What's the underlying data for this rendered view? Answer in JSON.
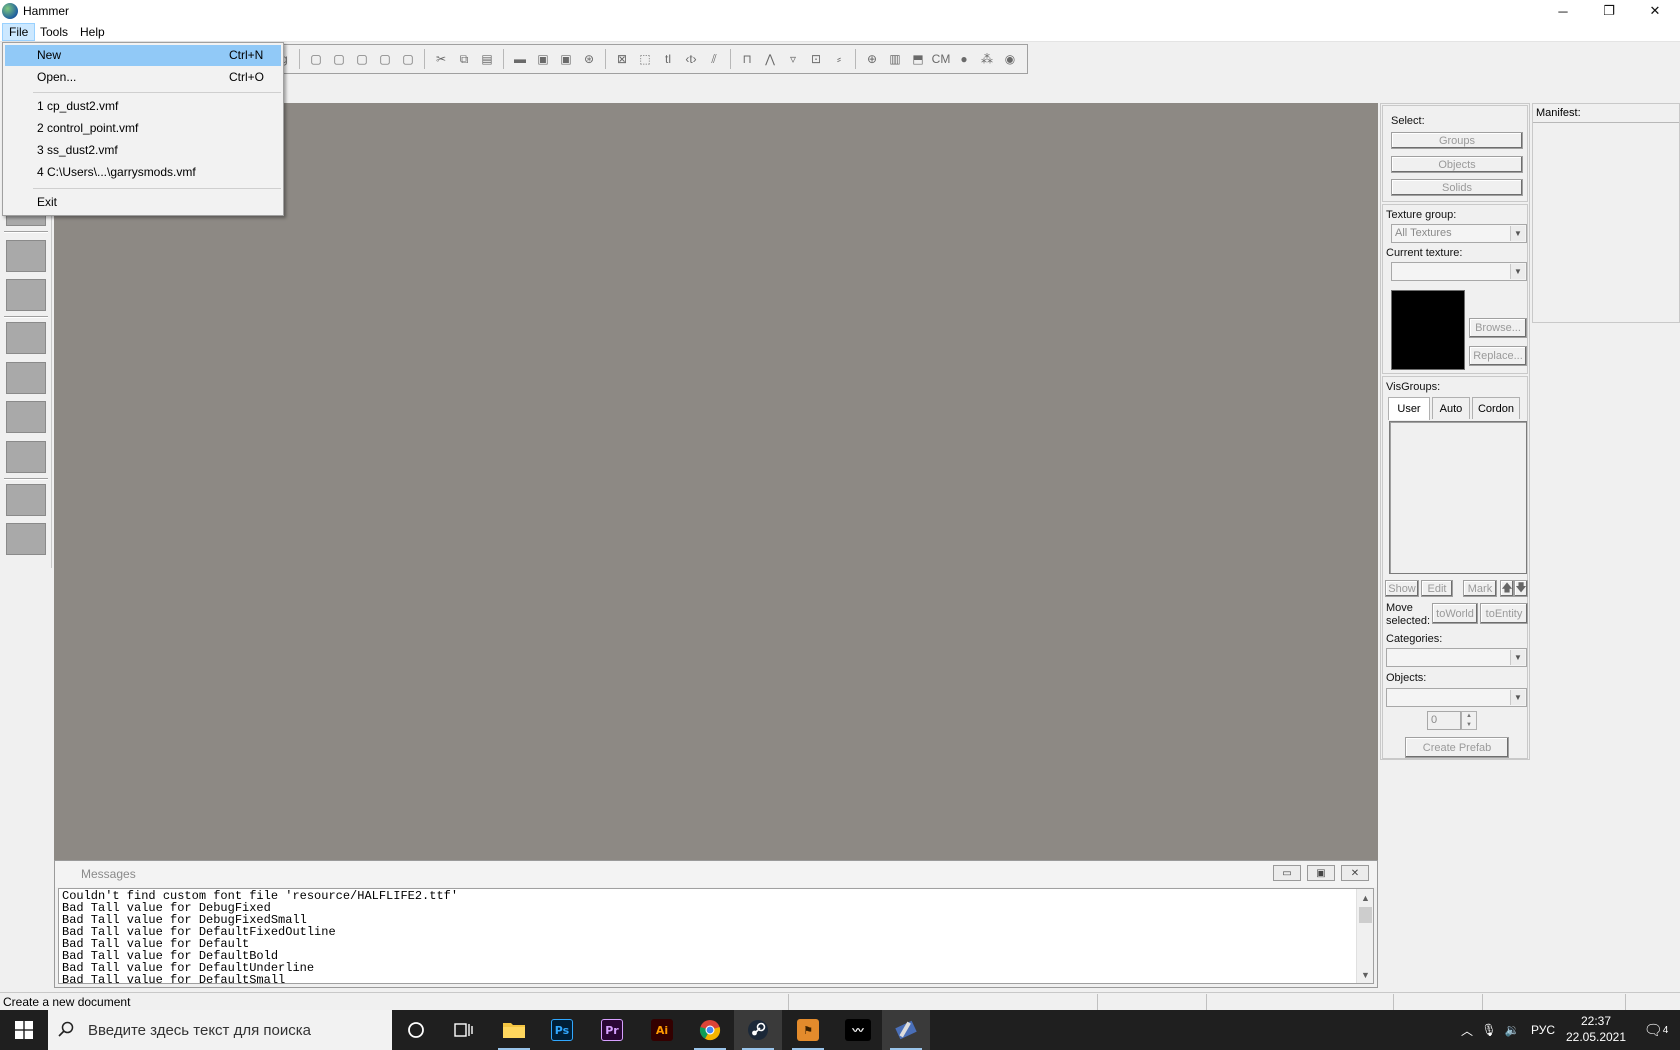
{
  "window": {
    "title": "Hammer",
    "controls": {
      "minimize": "─",
      "restore": "❐",
      "close": "✕"
    }
  },
  "menubar": {
    "items": [
      {
        "label": "File",
        "active": true
      },
      {
        "label": "Tools",
        "active": false
      },
      {
        "label": "Help",
        "active": false
      }
    ]
  },
  "file_menu": {
    "items": [
      {
        "label": "New",
        "shortcut": "Ctrl+N",
        "highlighted": true
      },
      {
        "label": "Open...",
        "shortcut": "Ctrl+O"
      },
      {
        "label": "1 cp_dust2.vmf"
      },
      {
        "label": "2 control_point.vmf"
      },
      {
        "label": "3 ss_dust2.vmf"
      },
      {
        "label": "4 C:\\Users\\...\\garrysmods.vmf"
      },
      {
        "label": "Exit"
      }
    ]
  },
  "toolbar": {
    "icons": [
      "ig",
      "▢",
      "▢",
      "▢",
      "▢",
      "▢",
      "✂",
      "⧉",
      "▤",
      "▬",
      "▣",
      "▣",
      "⊛",
      "⊠",
      "⬚",
      "tl",
      "‹t›",
      "⫽",
      "⊓",
      "⋀",
      "▿",
      "⊡",
      "⸗",
      "⊕",
      "▥",
      "⬒",
      "CM",
      "●",
      "⁂",
      "◉"
    ]
  },
  "viewport": {
    "background": "#8d8984"
  },
  "messages": {
    "title": "Messages",
    "lines": [
      "Couldn't find custom font file 'resource/HALFLIFE2.ttf'",
      "Bad Tall value for DebugFixed",
      "Bad Tall value for DebugFixedSmall",
      "Bad Tall value for DefaultFixedOutline",
      "Bad Tall value for Default",
      "Bad Tall value for DefaultBold",
      "Bad Tall value for DefaultUnderline",
      "Bad Tall value for DefaultSmall"
    ]
  },
  "right_panel": {
    "select_label": "Select:",
    "select_buttons": [
      "Groups",
      "Objects",
      "Solids"
    ],
    "texture_group_label": "Texture group:",
    "texture_group_value": "All Textures",
    "current_texture_label": "Current texture:",
    "current_texture_value": "",
    "browse_button": "Browse...",
    "replace_button": "Replace...",
    "visgroups_label": "VisGroups:",
    "visgroup_tabs": [
      "User",
      "Auto",
      "Cordon"
    ],
    "visgroup_buttons": [
      "Show",
      "Edit",
      "Mark"
    ],
    "up_arrow": "🡅",
    "down_arrow": "🡇",
    "move_selected_label": "Move\nselected:",
    "to_world_button": "toWorld",
    "to_entity_button": "toEntity",
    "categories_label": "Categories:",
    "objects_label": "Objects:",
    "spin_value": "0",
    "create_prefab_button": "Create Prefab"
  },
  "manifest": {
    "label": "Manifest:"
  },
  "statusbar": {
    "text": "Create a new document"
  },
  "taskbar": {
    "search_placeholder": "Введите здесь текст для поиска",
    "apps": [
      {
        "name": "cortana",
        "glyph": "○"
      },
      {
        "name": "task-view",
        "glyph": "⧉"
      },
      {
        "name": "file-explorer",
        "glyph": ""
      },
      {
        "name": "photoshop",
        "glyph": "Ps"
      },
      {
        "name": "premiere",
        "glyph": "Pr"
      },
      {
        "name": "illustrator",
        "glyph": "Ai"
      },
      {
        "name": "chrome",
        "glyph": ""
      },
      {
        "name": "steam",
        "glyph": ""
      },
      {
        "name": "counter-strike",
        "glyph": ""
      },
      {
        "name": "steam-vr",
        "glyph": ""
      },
      {
        "name": "hammer",
        "glyph": ""
      }
    ],
    "language": "РУС",
    "time": "22:37",
    "date": "22.05.2021",
    "notification_count": "4",
    "colors": {
      "photoshop": "#31a8ff",
      "premiere": "#d7a0ff",
      "illustrator": "#ff9a00"
    }
  }
}
